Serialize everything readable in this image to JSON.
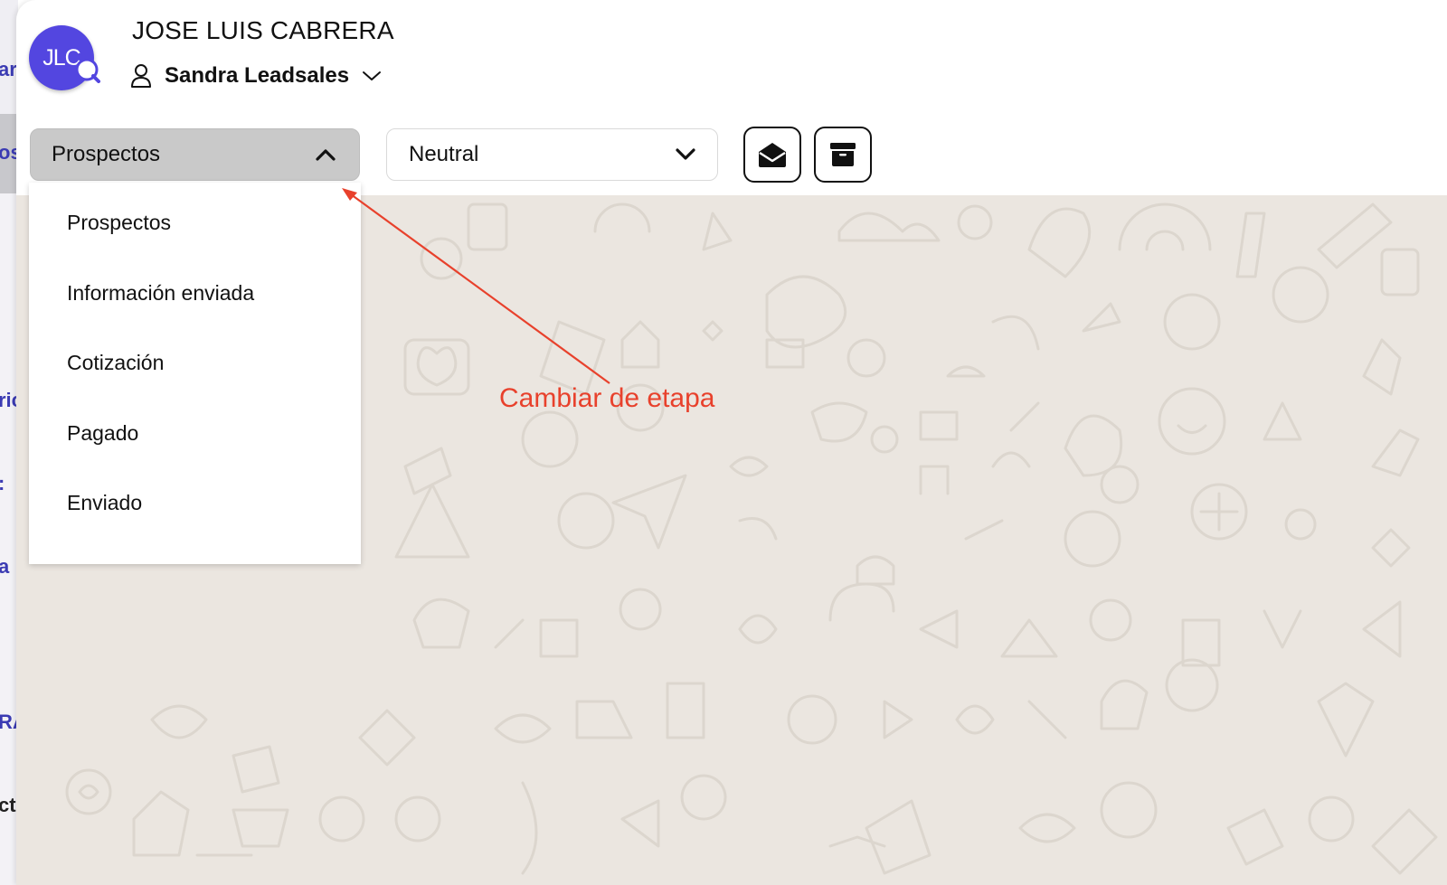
{
  "background_sidebar": {
    "fragments": [
      "ar",
      "os",
      "ric",
      ":",
      "a",
      "RA",
      "ct"
    ]
  },
  "header": {
    "avatar_initials": "JLC",
    "contact_name": "JOSE LUIS CABRERA",
    "agent_name": "Sandra Leadsales",
    "avatar_color": "#5346e0"
  },
  "controls": {
    "stage_select": {
      "value": "Prospectos",
      "expanded": true,
      "options": [
        "Prospectos",
        "Información enviada",
        "Cotización",
        "Pagado",
        "Enviado"
      ]
    },
    "sentiment_select": {
      "value": "Neutral"
    },
    "buttons": {
      "open_icon": "envelope-open-icon",
      "archive_icon": "archive-box-icon"
    }
  },
  "annotation": {
    "label": "Cambiar de etapa",
    "color": "#e8412c"
  },
  "chat_background": {
    "color": "#ebe6e0",
    "pattern": "doodle-wallpaper"
  }
}
